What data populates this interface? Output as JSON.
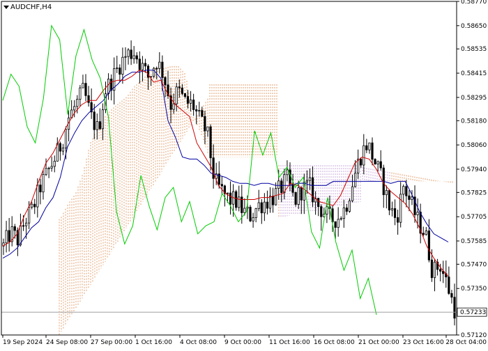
{
  "window": {
    "symbol": "AUDCHF,H4",
    "menu_icon": "triangle-down-icon"
  },
  "chart_data": {
    "type": "candlestick",
    "symbol": "AUDCHF",
    "timeframe": "H4",
    "ylim": [
      0.5712,
      0.5877
    ],
    "y_ticks": [
      0.5877,
      0.5865,
      0.58535,
      0.58415,
      0.58295,
      0.5818,
      0.5806,
      0.5794,
      0.57825,
      0.57705,
      0.57585,
      0.5747,
      0.5735,
      0.5712
    ],
    "x_ticks": [
      "19 Sep 2024",
      "24 Sep 08:00",
      "27 Sep 00:00",
      "1 Oct 16:00",
      "4 Oct 08:00",
      "9 Oct 00:00",
      "11 Oct 16:00",
      "16 Oct 08:00",
      "21 Oct 00:00",
      "23 Oct 16:00",
      "28 Oct 04:00"
    ],
    "current_price": "0.57233",
    "current_price_value": 0.57233,
    "colors": {
      "candle": "#000000",
      "tenkan": "#d00000",
      "kijun": "#0000a0",
      "chikou": "#00cc00",
      "cloud": "#e0a070",
      "cloud_b": "#c8a8d8",
      "price_line": "#a0a0a0",
      "price_tag_bg": "#ffffff"
    },
    "close_path": [
      0.5756,
      0.5763,
      0.5759,
      0.5769,
      0.5774,
      0.5785,
      0.5792,
      0.5799,
      0.5807,
      0.582,
      0.5826,
      0.5833,
      0.582,
      0.5813,
      0.5833,
      0.5839,
      0.5846,
      0.5851,
      0.5852,
      0.5845,
      0.5839,
      0.5848,
      0.5841,
      0.5826,
      0.5833,
      0.5827,
      0.5826,
      0.5818,
      0.5812,
      0.5788,
      0.5783,
      0.5779,
      0.5778,
      0.5773,
      0.5771,
      0.5776,
      0.5778,
      0.578,
      0.5784,
      0.5789,
      0.5778,
      0.5784,
      0.5786,
      0.5777,
      0.5773,
      0.5769,
      0.577,
      0.5775,
      0.5788,
      0.58,
      0.5807,
      0.5798,
      0.5789,
      0.5776,
      0.5769,
      0.5786,
      0.5777,
      0.5768,
      0.5762,
      0.5743,
      0.5747,
      0.5737,
      0.5725
    ],
    "tenkan": [
      0.5756,
      0.5758,
      0.5762,
      0.5771,
      0.5778,
      0.5788,
      0.5797,
      0.5802,
      0.5809,
      0.5816,
      0.5822,
      0.5826,
      0.5828,
      0.5828,
      0.5833,
      0.5837,
      0.5838,
      0.5838,
      0.584,
      0.5843,
      0.5842,
      0.5837,
      0.5838,
      0.5831,
      0.5826,
      0.5823,
      0.582,
      0.5807,
      0.5801,
      0.5795,
      0.5786,
      0.5782,
      0.578,
      0.5779,
      0.5779,
      0.5779,
      0.578,
      0.578,
      0.5781,
      0.5782,
      0.5787,
      0.5786,
      0.5784,
      0.5781,
      0.5778,
      0.5777,
      0.5776,
      0.5781,
      0.5789,
      0.5797,
      0.58,
      0.5799,
      0.5794,
      0.5787,
      0.5783,
      0.578,
      0.5777,
      0.5772,
      0.5765,
      0.5756,
      0.575,
      0.5745,
      0.5741
    ],
    "kijun": [
      0.575,
      0.5752,
      0.5755,
      0.576,
      0.5765,
      0.5768,
      0.5775,
      0.578,
      0.579,
      0.5805,
      0.5812,
      0.5818,
      0.5822,
      0.5825,
      0.5828,
      0.5833,
      0.5836,
      0.584,
      0.5842,
      0.5842,
      0.5843,
      0.5843,
      0.5839,
      0.5818,
      0.581,
      0.58,
      0.5799,
      0.5799,
      0.5796,
      0.5792,
      0.5791,
      0.579,
      0.5788,
      0.5787,
      0.5787,
      0.5786,
      0.5787,
      0.5787,
      0.5786,
      0.5786,
      0.5786,
      0.5787,
      0.5787,
      0.5786,
      0.5786,
      0.5786,
      0.5788,
      0.5788,
      0.5788,
      0.5788,
      0.5788,
      0.5788,
      0.5788,
      0.5788,
      0.5787,
      0.5788,
      0.5788,
      0.5781,
      0.5773,
      0.5767,
      0.5762,
      0.576,
      0.5758
    ],
    "chikou": [
      0.5828,
      0.5841,
      0.5835,
      0.5815,
      0.5807,
      0.5829,
      0.5865,
      0.5858,
      0.5821,
      0.585,
      0.5863,
      0.5848,
      0.5839,
      0.582,
      0.5773,
      0.5757,
      0.5766,
      0.5791,
      0.5776,
      0.5764,
      0.578,
      0.5785,
      0.5768,
      0.5778,
      0.5762,
      0.5766,
      0.5768,
      0.5782,
      0.5776,
      0.5768,
      0.5773,
      0.5813,
      0.5801,
      0.5812,
      0.579,
      0.5795,
      0.5785,
      0.579,
      0.5763,
      0.5755,
      0.578,
      0.5758,
      0.5744,
      0.5754,
      0.573,
      0.574,
      0.5722
    ]
  }
}
